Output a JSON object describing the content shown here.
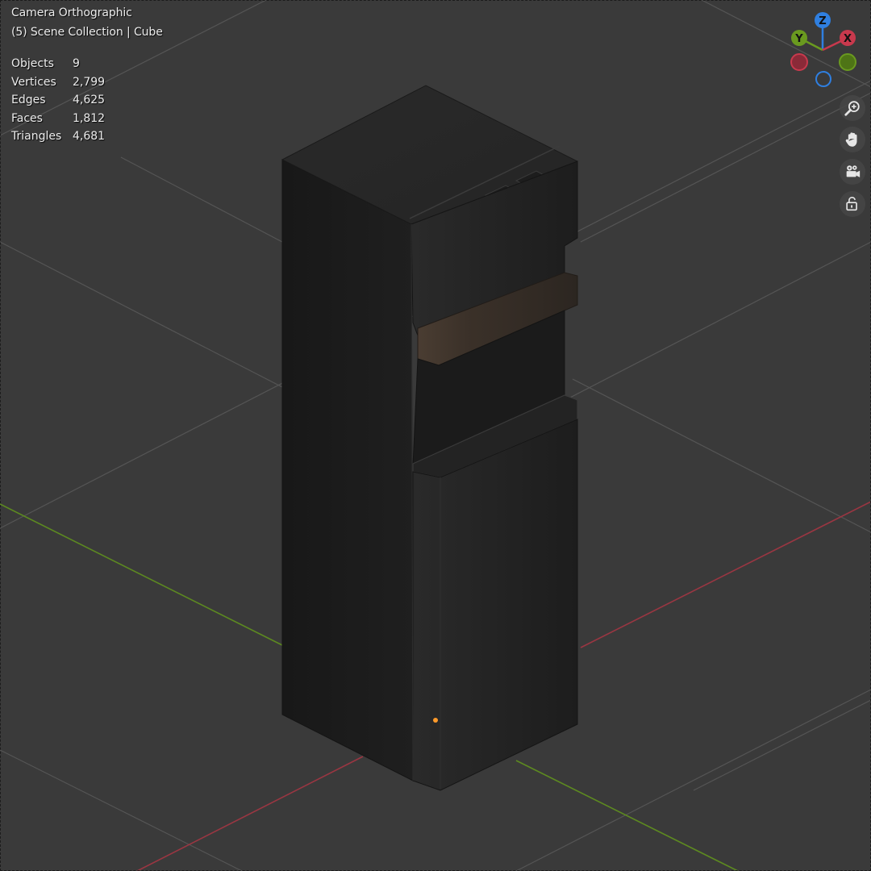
{
  "viewport": {
    "view_label": "Camera Orthographic",
    "collection_label": "(5) Scene Collection | Cube"
  },
  "stats": [
    {
      "name": "Objects",
      "value": "9"
    },
    {
      "name": "Vertices",
      "value": "2,799"
    },
    {
      "name": "Edges",
      "value": "4,625"
    },
    {
      "name": "Faces",
      "value": "1,812"
    },
    {
      "name": "Triangles",
      "value": "4,681"
    }
  ],
  "gizmo": {
    "z_label": "Z",
    "y_label": "Y",
    "x_label": "X",
    "x_color": "#c8394d",
    "y_color": "#6a9a1f",
    "z_color": "#2f7fe0"
  },
  "nav_buttons": [
    {
      "icon": "zoom-in-icon"
    },
    {
      "icon": "hand-icon"
    },
    {
      "icon": "camera-icon"
    },
    {
      "icon": "lock-icon"
    }
  ],
  "colors": {
    "background": "#3a3a3a",
    "grid": "#555555",
    "x_axis": "#9a3642",
    "y_axis": "#5d8a20",
    "origin_dot": "#ff9a2a"
  }
}
